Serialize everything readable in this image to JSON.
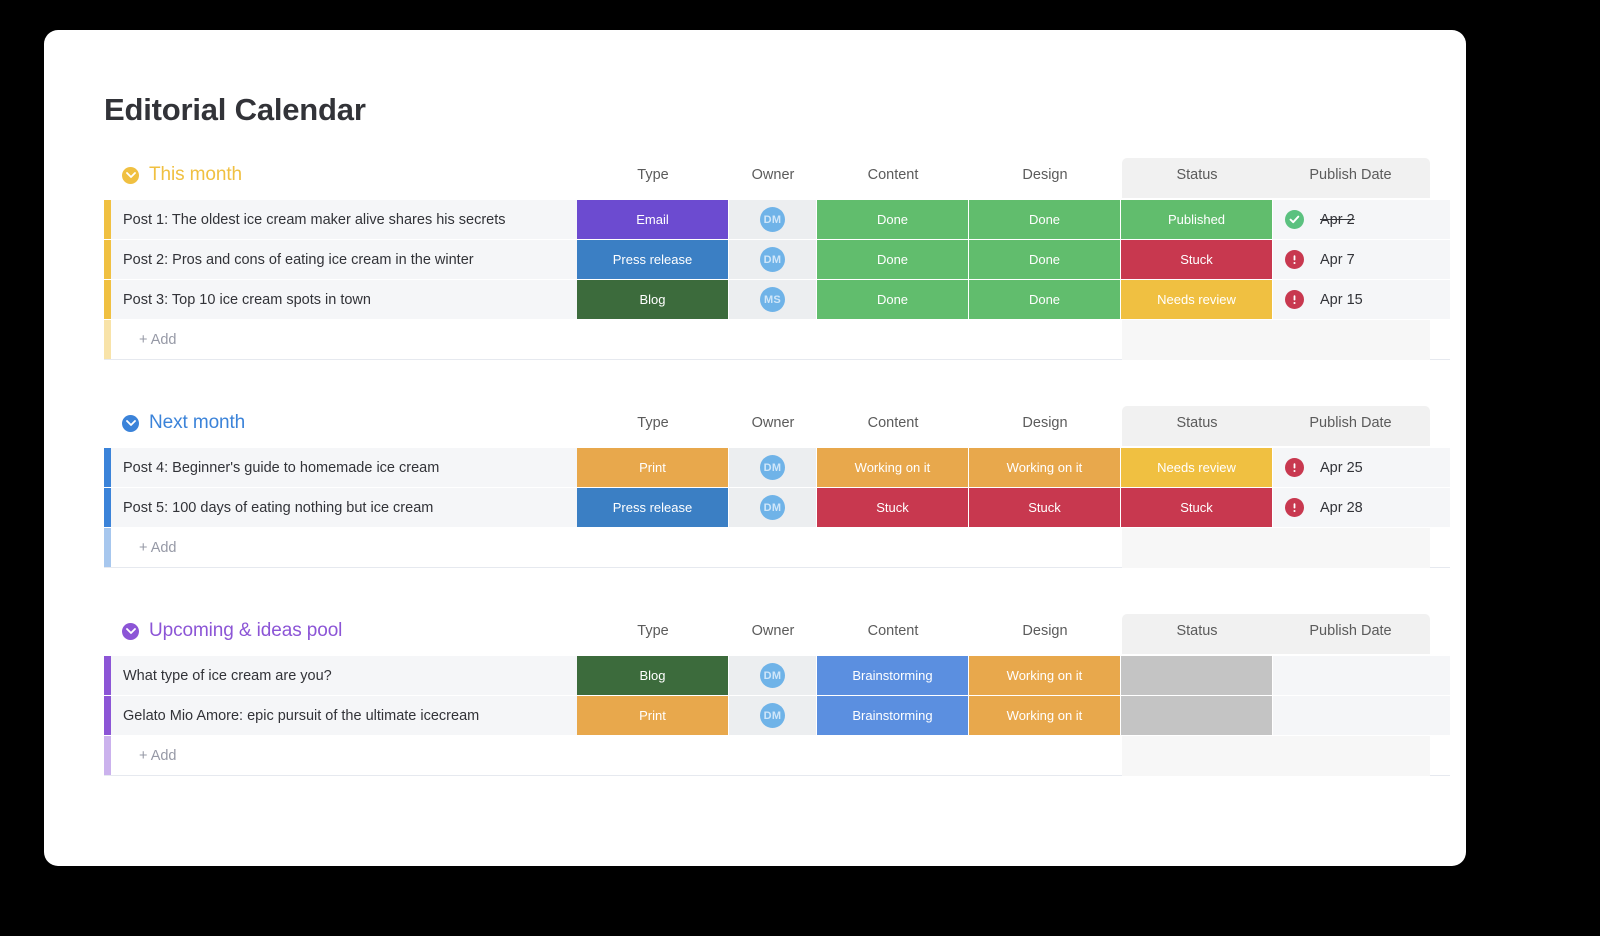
{
  "page": {
    "title": "Editorial Calendar",
    "background": "#000000",
    "card_background": "#ffffff"
  },
  "columns": {
    "name": "",
    "type": "Type",
    "owner": "Owner",
    "content": "Content",
    "design": "Design",
    "status": "Status",
    "date": "Publish Date"
  },
  "add_label": "+ Add",
  "palette": {
    "email": "#6c4bd0",
    "press_release": "#3b7fc4",
    "blog": "#3c6b3c",
    "print": "#e8a84c",
    "done": "#61bd6d",
    "working_on_it": "#e8a84c",
    "stuck": "#c8384f",
    "needs_review": "#f0c041",
    "brainstorming": "#5b8fe0",
    "published": "#61bd6d",
    "empty": "#c4c4c4",
    "group_this_month": "#f0c041",
    "group_next_month": "#3b83d9",
    "group_upcoming": "#8c55d6"
  },
  "groups": [
    {
      "title": "This month",
      "color": "#f0c041",
      "rows": [
        {
          "name": "Post 1: The oldest ice cream maker alive shares his secrets",
          "type": {
            "label": "Email",
            "color": "#6c4bd0"
          },
          "owner": "DM",
          "content": {
            "label": "Done",
            "color": "#61bd6d"
          },
          "design": {
            "label": "Done",
            "color": "#61bd6d"
          },
          "status": {
            "label": "Published",
            "color": "#61bd6d"
          },
          "date": {
            "text": "Apr 2",
            "icon": "check-circle-icon",
            "struck": true
          }
        },
        {
          "name": "Post 2: Pros and cons of eating ice cream in the winter",
          "type": {
            "label": "Press release",
            "color": "#3b7fc4"
          },
          "owner": "DM",
          "content": {
            "label": "Done",
            "color": "#61bd6d"
          },
          "design": {
            "label": "Done",
            "color": "#61bd6d"
          },
          "status": {
            "label": "Stuck",
            "color": "#c8384f"
          },
          "date": {
            "text": "Apr 7",
            "icon": "alert-circle-icon",
            "struck": false
          }
        },
        {
          "name": "Post 3: Top 10 ice cream spots in town",
          "type": {
            "label": "Blog",
            "color": "#3c6b3c"
          },
          "owner": "MS",
          "content": {
            "label": "Done",
            "color": "#61bd6d"
          },
          "design": {
            "label": "Done",
            "color": "#61bd6d"
          },
          "status": {
            "label": "Needs review",
            "color": "#f0c041"
          },
          "date": {
            "text": "Apr 15",
            "icon": "alert-circle-icon",
            "struck": false
          }
        }
      ]
    },
    {
      "title": "Next month",
      "color": "#3b83d9",
      "rows": [
        {
          "name": "Post 4: Beginner's guide to homemade ice cream",
          "type": {
            "label": "Print",
            "color": "#e8a84c"
          },
          "owner": "DM",
          "content": {
            "label": "Working on it",
            "color": "#e8a84c"
          },
          "design": {
            "label": "Working on it",
            "color": "#e8a84c"
          },
          "status": {
            "label": "Needs review",
            "color": "#f0c041"
          },
          "date": {
            "text": "Apr 25",
            "icon": "alert-circle-icon",
            "struck": false
          }
        },
        {
          "name": "Post 5: 100 days of eating nothing but ice cream",
          "type": {
            "label": "Press release",
            "color": "#3b7fc4"
          },
          "owner": "DM",
          "content": {
            "label": "Stuck",
            "color": "#c8384f"
          },
          "design": {
            "label": "Stuck",
            "color": "#c8384f"
          },
          "status": {
            "label": "Stuck",
            "color": "#c8384f"
          },
          "date": {
            "text": "Apr 28",
            "icon": "alert-circle-icon",
            "struck": false
          }
        }
      ]
    },
    {
      "title": "Upcoming & ideas pool",
      "color": "#8c55d6",
      "rows": [
        {
          "name": "What type of ice cream are you?",
          "type": {
            "label": "Blog",
            "color": "#3c6b3c"
          },
          "owner": "DM",
          "content": {
            "label": "Brainstorming",
            "color": "#5b8fe0"
          },
          "design": {
            "label": "Working on it",
            "color": "#e8a84c"
          },
          "status": {
            "label": "",
            "color": "#c4c4c4"
          },
          "date": {
            "text": "",
            "icon": "none",
            "struck": false
          }
        },
        {
          "name": "Gelato Mio Amore: epic pursuit of the ultimate icecream",
          "type": {
            "label": "Print",
            "color": "#e8a84c"
          },
          "owner": "DM",
          "content": {
            "label": "Brainstorming",
            "color": "#5b8fe0"
          },
          "design": {
            "label": "Working on it",
            "color": "#e8a84c"
          },
          "status": {
            "label": "",
            "color": "#c4c4c4"
          },
          "date": {
            "text": "",
            "icon": "none",
            "struck": false
          }
        }
      ]
    }
  ]
}
